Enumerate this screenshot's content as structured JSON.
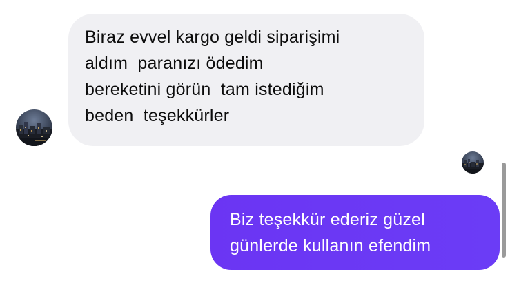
{
  "conversation": {
    "incoming": {
      "lines": [
        "Biraz evvel kargo geldi siparişimi",
        "aldım  paranızı ödedim",
        "bereketini görün  tam istediğim",
        "beden  teşekkürler"
      ]
    },
    "outgoing": {
      "lines": [
        "Biz teşekkür ederiz güzel",
        "günlerde kullanın efendim"
      ]
    }
  },
  "colors": {
    "incoming_bubble": "#f0f0f3",
    "outgoing_bubble": "#6b38f5",
    "incoming_text": "#0c0c0c",
    "outgoing_text": "#ffffff"
  },
  "icons": {
    "sender_avatar": "avatar-photo",
    "read_receipt_avatar": "avatar-photo"
  }
}
